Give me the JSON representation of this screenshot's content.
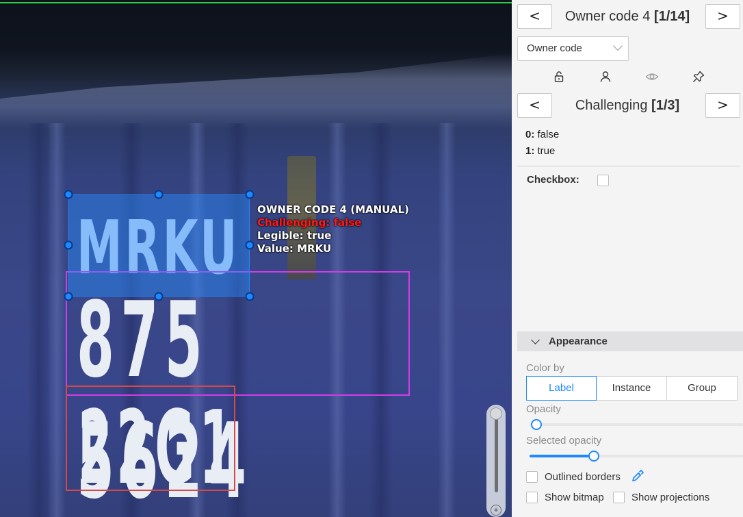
{
  "canvas": {
    "painted_codes": [
      "MRKU",
      "875 5624",
      "22G1"
    ],
    "annotation": {
      "title": "OWNER CODE 4 (MANUAL)",
      "challenging": "Challenging: false",
      "legible": "Legible: true",
      "value": "Value: MRKU"
    },
    "colors": {
      "selected_box": "#1e88ff",
      "second_box": "#d23ce6",
      "third_box": "#d84848"
    }
  },
  "panel": {
    "object_nav": {
      "prev": "<",
      "title": "Owner code 4",
      "count": "[1/14]",
      "next": ">"
    },
    "label_select": {
      "value": "Owner code"
    },
    "tools": [
      "unlock-icon",
      "person-icon",
      "eye-icon",
      "pin-icon"
    ],
    "attr_nav": {
      "prev": "<",
      "title": "Challenging",
      "count": "[1/3]",
      "next": ">"
    },
    "attr_values": [
      {
        "key": "0",
        "value": "false"
      },
      {
        "key": "1",
        "value": "true"
      }
    ],
    "checkbox_label": "Checkbox:",
    "appearance": {
      "header": "Appearance",
      "color_by_label": "Color by",
      "color_by_options": [
        "Label",
        "Instance",
        "Group"
      ],
      "color_by_selected": "Label",
      "opacity_label": "Opacity",
      "opacity_value": 0.0,
      "selected_opacity_label": "Selected opacity",
      "selected_opacity_value": 0.3,
      "outlined_borders_label": "Outlined borders",
      "show_bitmap_label": "Show bitmap",
      "show_projections_label": "Show projections"
    }
  }
}
